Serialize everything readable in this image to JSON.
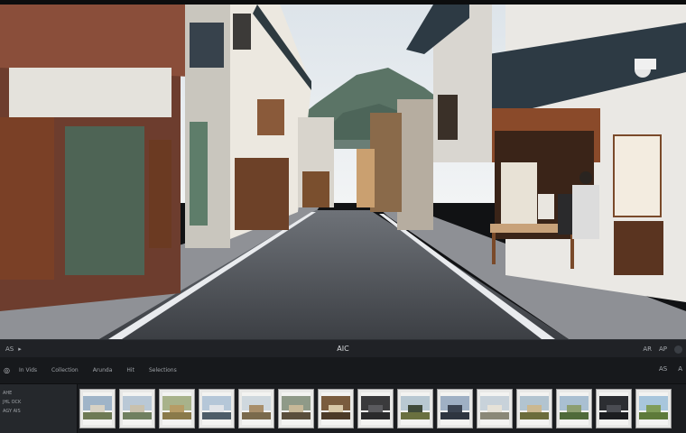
{
  "toolbar": {
    "left_label": "AS",
    "center_label": "AIC",
    "right_labels": [
      "AR",
      "AP"
    ]
  },
  "tabs": [
    {
      "label": "In Vids"
    },
    {
      "label": "Collection"
    },
    {
      "label": "Arunda"
    },
    {
      "label": "Hit"
    },
    {
      "label": "Selections"
    }
  ],
  "tab_right": [
    "AS",
    "A"
  ],
  "sidepanel": {
    "lines": [
      "AHE",
      "JHL OCK",
      "AGY AIS"
    ]
  },
  "filmstrip": {
    "thumbnails": [
      {
        "name": "thumb-1",
        "sky": "#9fb4c8",
        "ground": "#6e7a55",
        "subject": "#d8d2c4"
      },
      {
        "name": "thumb-2",
        "sky": "#b9c8d6",
        "ground": "#708060",
        "subject": "#c9c1ad"
      },
      {
        "name": "thumb-3",
        "sky": "#a8b28a",
        "ground": "#8a7a4a",
        "subject": "#b69c66"
      },
      {
        "name": "thumb-4",
        "sky": "#b5c7d8",
        "ground": "#4e5d68",
        "subject": "#e1e4e8"
      },
      {
        "name": "thumb-5",
        "sky": "#cfd8de",
        "ground": "#7a6a4c",
        "subject": "#a88e6a"
      },
      {
        "name": "thumb-6",
        "sky": "#8f9a88",
        "ground": "#5a4e3c",
        "subject": "#c7b898"
      },
      {
        "name": "thumb-7",
        "sky": "#7a5c3e",
        "ground": "#4c3a28",
        "subject": "#d8c8a8"
      },
      {
        "name": "thumb-8",
        "sky": "#3a3a3c",
        "ground": "#2a2a2c",
        "subject": "#5a5a5e"
      },
      {
        "name": "thumb-9",
        "sky": "#b8c8d2",
        "ground": "#6a7040",
        "subject": "#3f4a3a"
      },
      {
        "name": "thumb-10",
        "sky": "#9fb0c4",
        "ground": "#2e3540",
        "subject": "#3b4452"
      },
      {
        "name": "thumb-11",
        "sky": "#c8d2da",
        "ground": "#8a8878",
        "subject": "#e6e2d8"
      },
      {
        "name": "thumb-12",
        "sky": "#b2c4d0",
        "ground": "#6b6c3c",
        "subject": "#cbb890"
      },
      {
        "name": "thumb-13",
        "sky": "#a9bfd1",
        "ground": "#4f6a3a",
        "subject": "#8c9e70"
      },
      {
        "name": "thumb-14",
        "sky": "#2c2e32",
        "ground": "#1c1d20",
        "subject": "#4a4c52"
      },
      {
        "name": "thumb-15",
        "sky": "#a8c6dc",
        "ground": "#5e7a3a",
        "subject": "#7f9c58"
      }
    ]
  }
}
